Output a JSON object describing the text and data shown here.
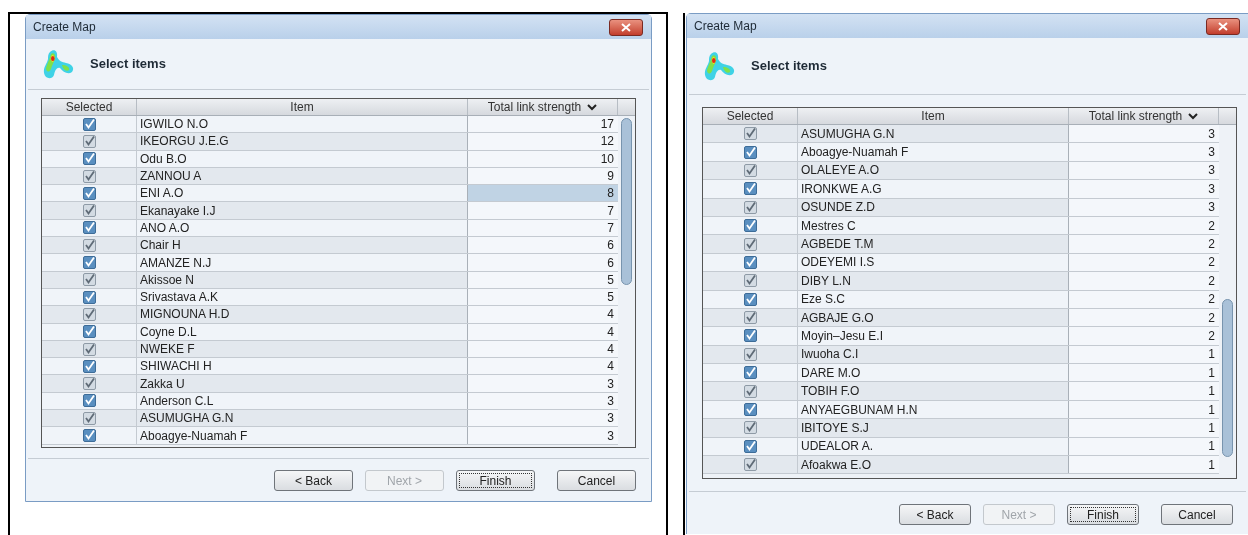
{
  "dialogs": [
    {
      "title": "Create Map",
      "heading": "Select items",
      "columns": [
        "Selected",
        "Item",
        "Total link strength"
      ],
      "rows": [
        {
          "checked": true,
          "item": "IGWILO N.O",
          "strength": "17",
          "selected": false
        },
        {
          "checked": true,
          "item": "IKEORGU J.E.G",
          "strength": "12",
          "selected": false
        },
        {
          "checked": true,
          "item": "Odu B.O",
          "strength": "10",
          "selected": false
        },
        {
          "checked": true,
          "item": "ZANNOU A",
          "strength": "9",
          "selected": false
        },
        {
          "checked": true,
          "item": "ENI A.O",
          "strength": "8",
          "selected": true
        },
        {
          "checked": true,
          "item": "Ekanayake I.J",
          "strength": "7",
          "selected": false
        },
        {
          "checked": true,
          "item": "ANO A.O",
          "strength": "7",
          "selected": false
        },
        {
          "checked": true,
          "item": "Chair H",
          "strength": "6",
          "selected": false
        },
        {
          "checked": true,
          "item": "AMANZE N.J",
          "strength": "6",
          "selected": false
        },
        {
          "checked": true,
          "item": "Akissoe N",
          "strength": "5",
          "selected": false
        },
        {
          "checked": true,
          "item": "Srivastava A.K",
          "strength": "5",
          "selected": false
        },
        {
          "checked": true,
          "item": "MIGNOUNA H.D",
          "strength": "4",
          "selected": false
        },
        {
          "checked": true,
          "item": "Coyne D.L",
          "strength": "4",
          "selected": false
        },
        {
          "checked": true,
          "item": "NWEKE F",
          "strength": "4",
          "selected": false
        },
        {
          "checked": true,
          "item": "SHIWACHI H",
          "strength": "4",
          "selected": false
        },
        {
          "checked": true,
          "item": "Zakka U",
          "strength": "3",
          "selected": false
        },
        {
          "checked": true,
          "item": "Anderson C.L",
          "strength": "3",
          "selected": false
        },
        {
          "checked": true,
          "item": "ASUMUGHA G.N",
          "strength": "3",
          "selected": false
        },
        {
          "checked": true,
          "item": "Aboagye-Nuamah F",
          "strength": "3",
          "selected": false
        }
      ],
      "buttons": [
        {
          "label": "< Back",
          "disabled": false,
          "default": false
        },
        {
          "label": "Next >",
          "disabled": true,
          "default": false
        },
        {
          "label": "Finish",
          "disabled": false,
          "default": true
        },
        {
          "label": "Cancel",
          "disabled": false,
          "default": false
        }
      ]
    },
    {
      "title": "Create Map",
      "heading": "Select items",
      "columns": [
        "Selected",
        "Item",
        "Total link strength"
      ],
      "rows": [
        {
          "checked": true,
          "item": "ASUMUGHA G.N",
          "strength": "3",
          "selected": false
        },
        {
          "checked": true,
          "item": "Aboagye-Nuamah F",
          "strength": "3",
          "selected": false
        },
        {
          "checked": true,
          "item": "OLALEYE A.O",
          "strength": "3",
          "selected": false
        },
        {
          "checked": true,
          "item": "IRONKWE A.G",
          "strength": "3",
          "selected": false
        },
        {
          "checked": true,
          "item": "OSUNDE Z.D",
          "strength": "3",
          "selected": false
        },
        {
          "checked": true,
          "item": "Mestres C",
          "strength": "2",
          "selected": false
        },
        {
          "checked": true,
          "item": "AGBEDE T.M",
          "strength": "2",
          "selected": false
        },
        {
          "checked": true,
          "item": "ODEYEMI I.S",
          "strength": "2",
          "selected": false
        },
        {
          "checked": true,
          "item": "DIBY L.N",
          "strength": "2",
          "selected": false
        },
        {
          "checked": true,
          "item": "Eze S.C",
          "strength": "2",
          "selected": false
        },
        {
          "checked": true,
          "item": "AGBAJE G.O",
          "strength": "2",
          "selected": false
        },
        {
          "checked": true,
          "item": "Moyin–Jesu E.I",
          "strength": "2",
          "selected": false
        },
        {
          "checked": true,
          "item": "Iwuoha C.I",
          "strength": "1",
          "selected": false
        },
        {
          "checked": true,
          "item": "DARE M.O",
          "strength": "1",
          "selected": false
        },
        {
          "checked": true,
          "item": "TOBIH F.O",
          "strength": "1",
          "selected": false
        },
        {
          "checked": true,
          "item": "ANYAEGBUNAM H.N",
          "strength": "1",
          "selected": false
        },
        {
          "checked": true,
          "item": "IBITOYE S.J",
          "strength": "1",
          "selected": false
        },
        {
          "checked": true,
          "item": "UDEALOR A.",
          "strength": "1",
          "selected": false
        },
        {
          "checked": true,
          "item": "Afoakwa E.O",
          "strength": "1",
          "selected": false
        }
      ],
      "buttons": [
        {
          "label": "< Back",
          "disabled": false,
          "default": false
        },
        {
          "label": "Next >",
          "disabled": true,
          "default": false
        },
        {
          "label": "Finish",
          "disabled": false,
          "default": true
        },
        {
          "label": "Cancel",
          "disabled": false,
          "default": false
        }
      ]
    }
  ]
}
